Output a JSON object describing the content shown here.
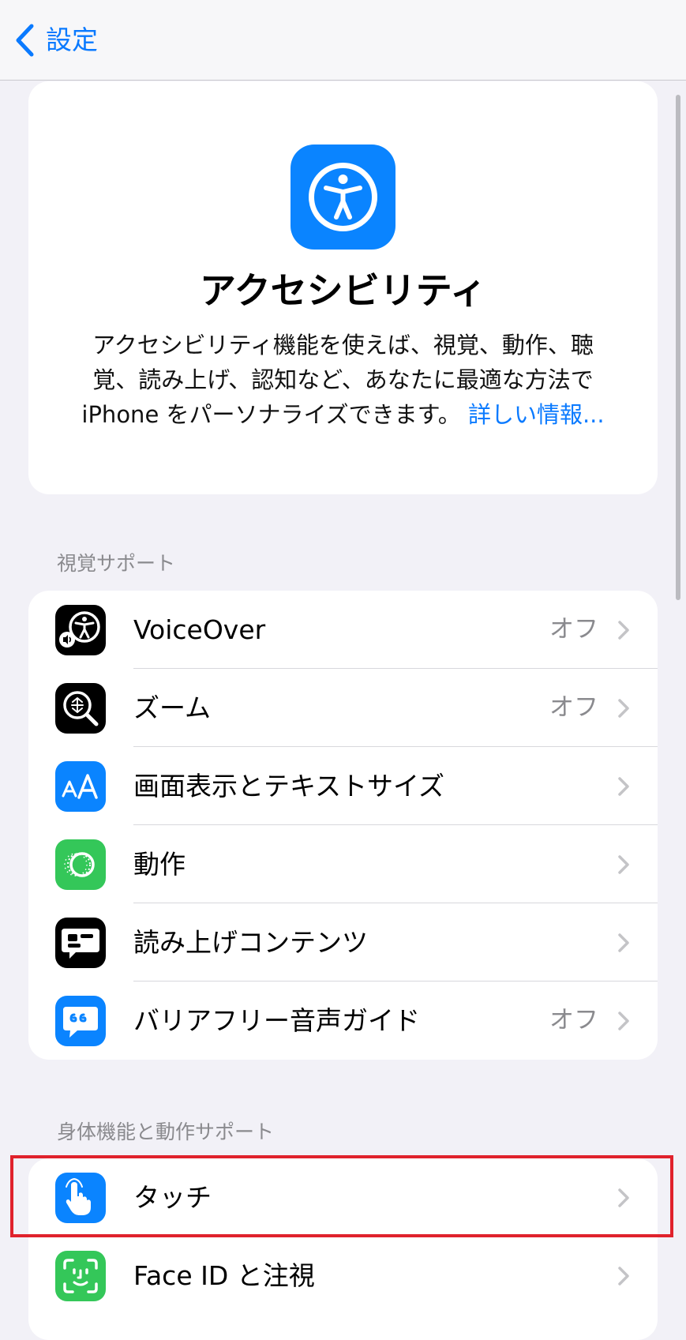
{
  "nav": {
    "back_label": "設定"
  },
  "hero": {
    "icon": "accessibility-icon",
    "title": "アクセシビリティ",
    "desc_line1": "アクセシビリティ機能を使えば、視覚、動作、聴",
    "desc_line2": "覚、読み上げ、認知など、あなたに最適な方法で",
    "desc_line3": "iPhone をパーソナライズできます。",
    "link": "詳しい情報..."
  },
  "sections": {
    "vision": {
      "header": "視覚サポート",
      "items": [
        {
          "label": "VoiceOver",
          "value": "オフ",
          "icon": "voiceover-icon"
        },
        {
          "label": "ズーム",
          "value": "オフ",
          "icon": "zoom-icon"
        },
        {
          "label": "画面表示とテキストサイズ",
          "value": "",
          "icon": "text-size-icon"
        },
        {
          "label": "動作",
          "value": "",
          "icon": "motion-icon"
        },
        {
          "label": "読み上げコンテンツ",
          "value": "",
          "icon": "spoken-content-icon"
        },
        {
          "label": "バリアフリー音声ガイド",
          "value": "オフ",
          "icon": "audio-descriptions-icon"
        }
      ]
    },
    "physical": {
      "header": "身体機能と動作サポート",
      "items": [
        {
          "label": "タッチ",
          "value": "",
          "icon": "touch-icon"
        },
        {
          "label": "Face ID と注視",
          "value": "",
          "icon": "face-id-icon"
        }
      ]
    }
  },
  "colors": {
    "accent": "#0a7aff",
    "highlight": "#e0222c",
    "background": "#f2f1f7"
  }
}
